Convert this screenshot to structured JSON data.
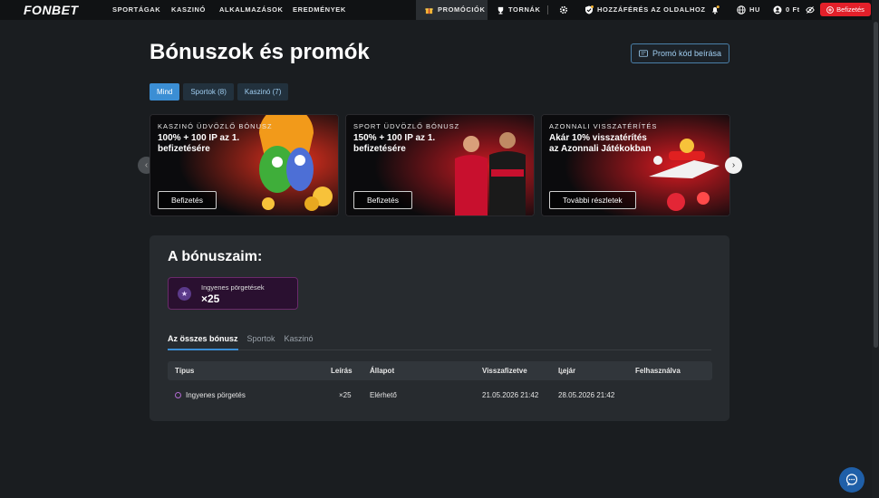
{
  "brand": {
    "logo": "FONBET",
    "accent": "#3b8ed4",
    "deposit_color": "#e3202a"
  },
  "nav": {
    "items": [
      "SPORTÁGAK",
      "KASZINÓ",
      "ALKALMAZÁSOK",
      "EREDMÉNYEK"
    ],
    "promo": "PROMÓCIÓK",
    "tournaments": "TORNÁK",
    "access": "HOZZÁFÉRÉS AZ OLDALHOZ",
    "language": "HU",
    "balance": "0 Ft",
    "deposit": "Befizetés"
  },
  "page": {
    "title": "Bónuszok és promók",
    "promo_code_button": "Promó kód beírása"
  },
  "filters": [
    {
      "label": "Mind",
      "active": true
    },
    {
      "label": "Sportok (8)",
      "active": false
    },
    {
      "label": "Kaszinó (7)",
      "active": false
    }
  ],
  "cards": [
    {
      "kicker": "KASZINÓ ÜDVÖZLŐ BÓNUSZ",
      "title": "100% + 100 IP az 1. befizetésére",
      "cta": "Befizetés"
    },
    {
      "kicker": "SPORT ÜDVÖZLŐ BÓNUSZ",
      "title": "150% + 100 IP az 1. befizetésére",
      "cta": "Befizetés"
    },
    {
      "kicker": "AZONNALI VISSZATÉRÍTÉS",
      "title": "Akár 10% visszatérítés az Azonnali Játékokban",
      "cta": "További részletek"
    }
  ],
  "my_bonuses": {
    "title": "A bónuszaim:",
    "free_spins": {
      "label": "Ingyenes pörgetések",
      "value": "×25"
    },
    "tabs": [
      {
        "label": "Az összes bónusz",
        "active": true
      },
      {
        "label": "Sportok",
        "active": false
      },
      {
        "label": "Kaszinó",
        "active": false
      }
    ],
    "columns": [
      "Típus",
      "Leírás",
      "Állapot",
      "Visszafizetve",
      "Lejár",
      "Felhasználva"
    ],
    "rows": [
      {
        "type": "Ingyenes pörgetés",
        "description": "×25",
        "status": "Elérhető",
        "repaid": "21.05.2026 21:42",
        "expires": "28.05.2026 21:42",
        "used": ""
      }
    ]
  }
}
